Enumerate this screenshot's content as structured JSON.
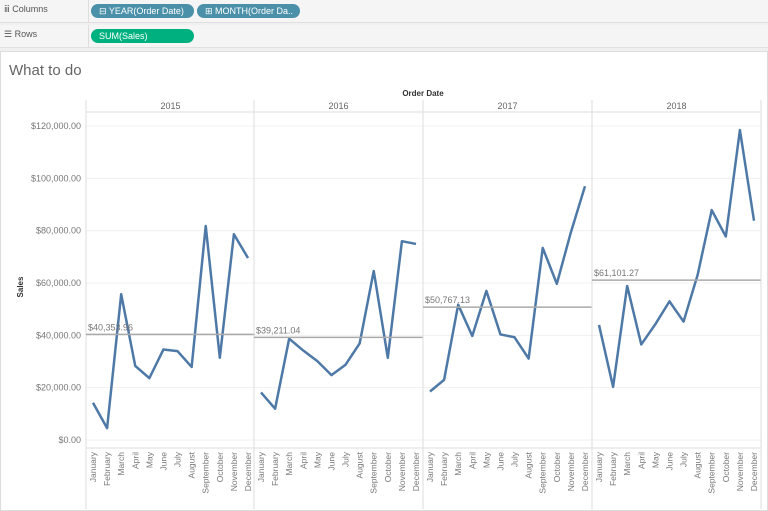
{
  "shelves": {
    "columns": {
      "label": "Columns",
      "icon": "columns-icon",
      "pills": [
        "YEAR(Order Date)",
        "MONTH(Order Da.."
      ]
    },
    "rows": {
      "label": "Rows",
      "icon": "rows-icon",
      "pills": [
        "SUM(Sales)"
      ]
    },
    "colors": {
      "dimension": "#4a90a8",
      "measure": "#00b180"
    }
  },
  "sheet": {
    "title": "What to do"
  },
  "chart_data": {
    "type": "line",
    "xlabel": "Order Date",
    "ylabel": "Sales",
    "ylim": [
      0,
      125000
    ],
    "yticks": [
      "$0.00",
      "$20,000.00",
      "$40,000.00",
      "$60,000.00",
      "$80,000.00",
      "$100,000.00",
      "$120,000.00"
    ],
    "ytick_values": [
      0,
      20000,
      40000,
      60000,
      80000,
      100000,
      120000
    ],
    "months": [
      "January",
      "February",
      "March",
      "April",
      "May",
      "June",
      "July",
      "August",
      "September",
      "October",
      "November",
      "December"
    ],
    "line_color": "#4e79a7",
    "reference_line": "average per year",
    "grid": true,
    "panes": [
      {
        "year": "2015",
        "avg_label": "$40,353.96",
        "avg": 40353.96,
        "values": [
          14237,
          4520,
          55691,
          28295,
          23648,
          34595,
          33946,
          27910,
          81777,
          31453,
          78629,
          69546
        ]
      },
      {
        "year": "2016",
        "avg_label": "$39,211.04",
        "avg": 39211.04,
        "values": [
          18174,
          11951,
          38726,
          34195,
          30132,
          24797,
          28765,
          36898,
          64596,
          31405,
          75973,
          74920
        ]
      },
      {
        "year": "2017",
        "avg_label": "$50,767.13",
        "avg": 50767.13,
        "values": [
          18542,
          22979,
          51716,
          39748,
          56988,
          40345,
          39262,
          31115,
          73410,
          59688,
          79412,
          96999
        ]
      },
      {
        "year": "2018",
        "avg_label": "$61,101.27",
        "avg": 61101.27,
        "values": [
          43971,
          20301,
          58872,
          36522,
          44261,
          52982,
          45264,
          63121,
          87867,
          77777,
          118448,
          83829
        ]
      }
    ]
  }
}
